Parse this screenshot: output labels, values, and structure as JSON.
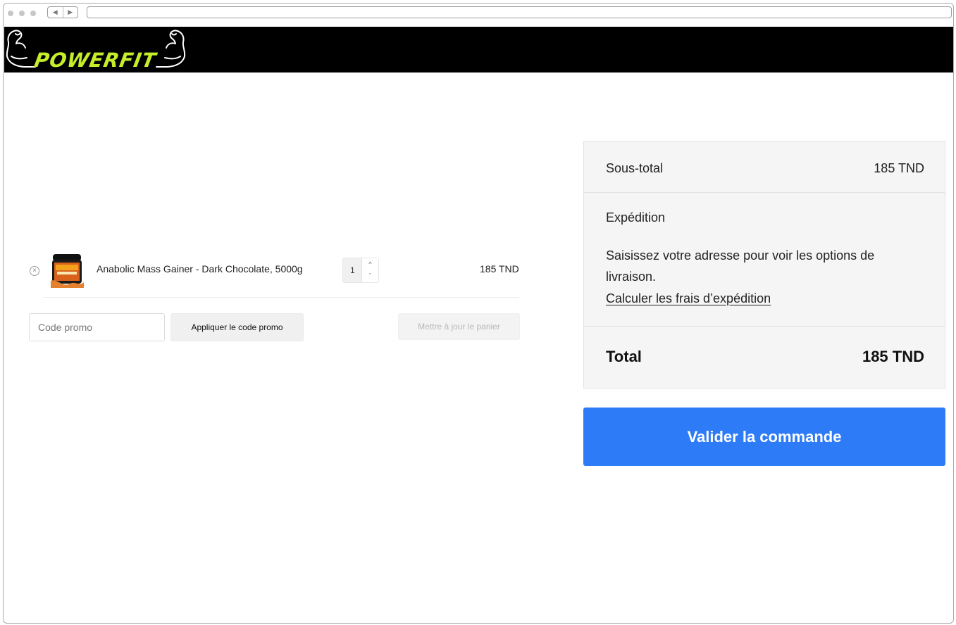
{
  "browser": {
    "back_icon": "back-arrow-icon",
    "forward_icon": "forward-arrow-icon",
    "back_glyph": "◀",
    "forward_glyph": "▶"
  },
  "header": {
    "logo_text": "POWERFIT",
    "background": "#000000",
    "logo_color": "#c5ee2a"
  },
  "cart": {
    "item": {
      "remove_glyph": "×",
      "name": "Anabolic Mass Gainer - Dark Chocolate, 5000g",
      "quantity": "1",
      "price": "185 TND",
      "up_glyph": "^",
      "down_glyph": "ˇ"
    },
    "promo_placeholder": "Code promo",
    "apply_label": "Appliquer le code promo",
    "update_label": "Mettre à jour le panier"
  },
  "totals": {
    "subtotal_label": "Sous-total",
    "subtotal_value": "185 TND",
    "shipping_label": "Expédition",
    "shipping_message": "Saisissez votre adresse pour voir les options de livraison.",
    "shipping_link": "Calculer les frais d’expédition",
    "total_label": "Total",
    "total_value": "185 TND"
  },
  "checkout": {
    "label": "Valider la commande",
    "color": "#2d7bf6"
  }
}
